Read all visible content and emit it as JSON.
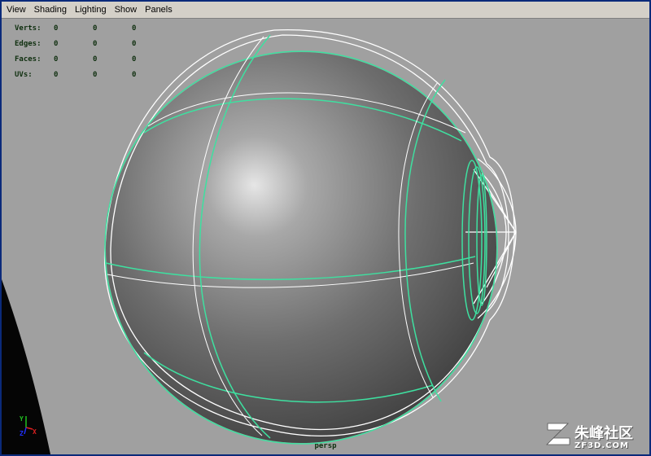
{
  "menu": {
    "items": [
      {
        "label": "View"
      },
      {
        "label": "Shading"
      },
      {
        "label": "Lighting"
      },
      {
        "label": "Show"
      },
      {
        "label": "Panels"
      }
    ]
  },
  "hud": {
    "rows": [
      {
        "label": "Verts:",
        "values": [
          "0",
          "0",
          "0"
        ]
      },
      {
        "label": "Edges:",
        "values": [
          "0",
          "0",
          "0"
        ]
      },
      {
        "label": "Faces:",
        "values": [
          "0",
          "0",
          "0"
        ]
      },
      {
        "label": "UVs:",
        "values": [
          "0",
          "0",
          "0"
        ]
      }
    ]
  },
  "viewport": {
    "camera_label": "persp",
    "background_color": "#a0a0a0",
    "wire_selected_color": "#3ee0a0",
    "wire_unselected_color": "#ffffff"
  },
  "axis_gizmo": {
    "y": "Y",
    "x": "X",
    "z": "Z",
    "colors": {
      "x": "#e02020",
      "y": "#20c020",
      "z": "#2030ff"
    }
  },
  "watermark": {
    "logo_text": "朱峰社区",
    "url": "ZF3D.COM"
  }
}
